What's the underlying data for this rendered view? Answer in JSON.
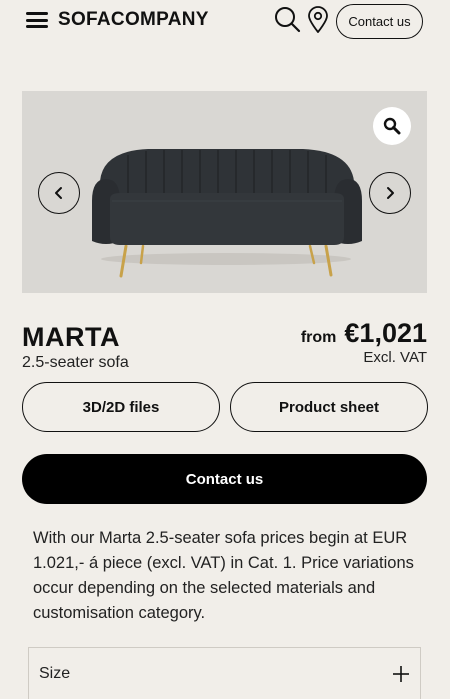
{
  "header": {
    "brand": "SOFACOMPANY",
    "contact_label": "Contact us",
    "icons": [
      "menu-icon",
      "search-icon",
      "location-pin-icon"
    ]
  },
  "gallery": {
    "image": "sofa-product-image",
    "icons": [
      "zoom-icon",
      "chevron-left-icon",
      "chevron-right-icon"
    ]
  },
  "product": {
    "name": "MARTA",
    "subtitle": "2.5-seater sofa",
    "price_prefix": "from",
    "price": "€1,021",
    "price_note": "Excl. VAT"
  },
  "actions": {
    "files_label": "3D/2D files",
    "sheet_label": "Product sheet",
    "contact_label": "Contact us"
  },
  "description": "With our Marta 2.5-seater sofa prices begin at EUR 1.021,- á piece (excl. VAT) in Cat. 1. Price variations occur depending on the selected materials and customisation category.",
  "accordion": {
    "size_label": "Size",
    "icon": "plus-icon"
  }
}
